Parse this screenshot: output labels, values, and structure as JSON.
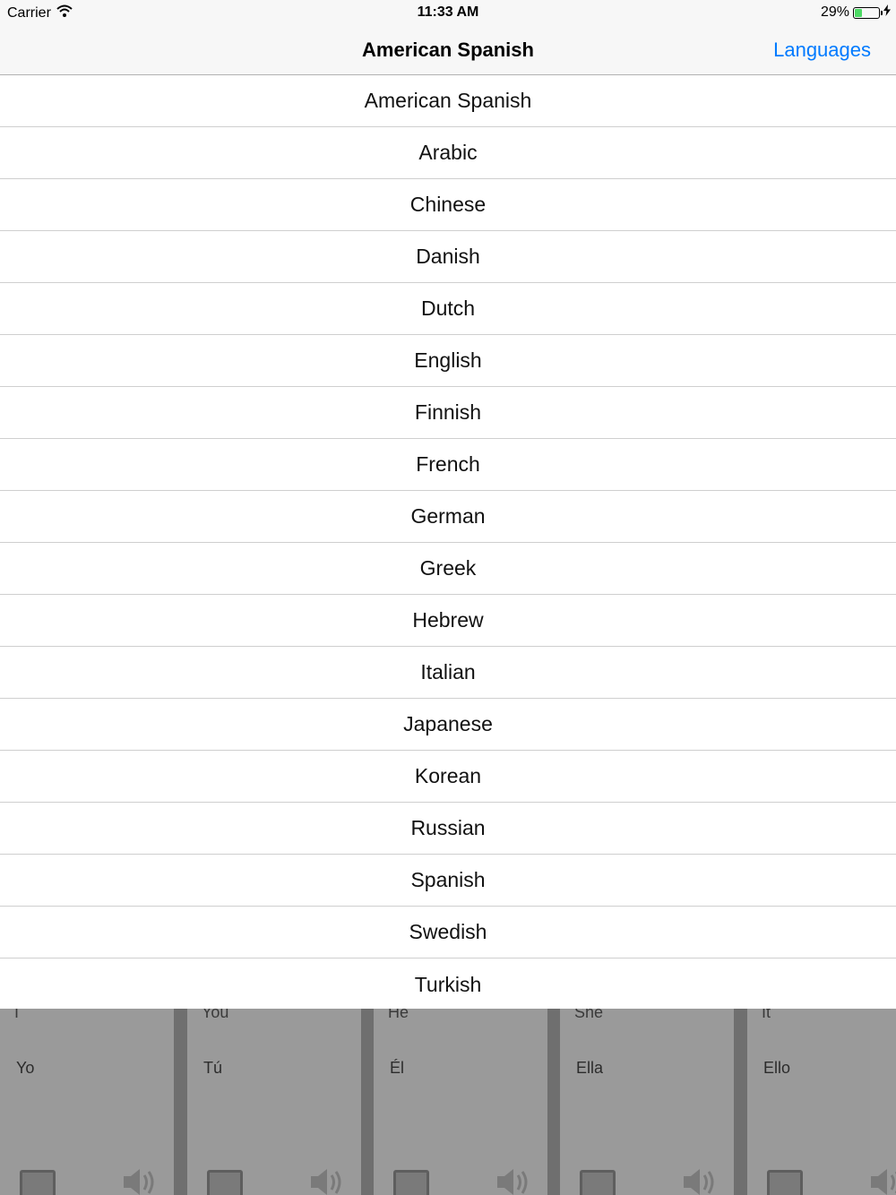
{
  "status_bar": {
    "carrier": "Carrier",
    "time": "11:33 AM",
    "battery_percent": "29%",
    "battery_level": 0.29,
    "battery_color": "#4cd964"
  },
  "nav": {
    "title": "American Spanish",
    "languages_button": "Languages",
    "accent_color": "#007aff"
  },
  "languages": [
    "American Spanish",
    "Arabic",
    "Chinese",
    "Danish",
    "Dutch",
    "English",
    "Finnish",
    "French",
    "German",
    "Greek",
    "Hebrew",
    "Italian",
    "Japanese",
    "Korean",
    "Russian",
    "Spanish",
    "Swedish",
    "Turkish"
  ],
  "cards": [
    {
      "english": "I",
      "translation": "Yo"
    },
    {
      "english": "You",
      "translation": "Tú"
    },
    {
      "english": "He",
      "translation": "Él"
    },
    {
      "english": "She",
      "translation": "Ella"
    },
    {
      "english": "It",
      "translation": "Ello"
    }
  ],
  "icons": {
    "wifi": "wifi-icon",
    "charging": "bolt-icon",
    "photo": "photo-icon",
    "speaker": "speaker-icon"
  }
}
